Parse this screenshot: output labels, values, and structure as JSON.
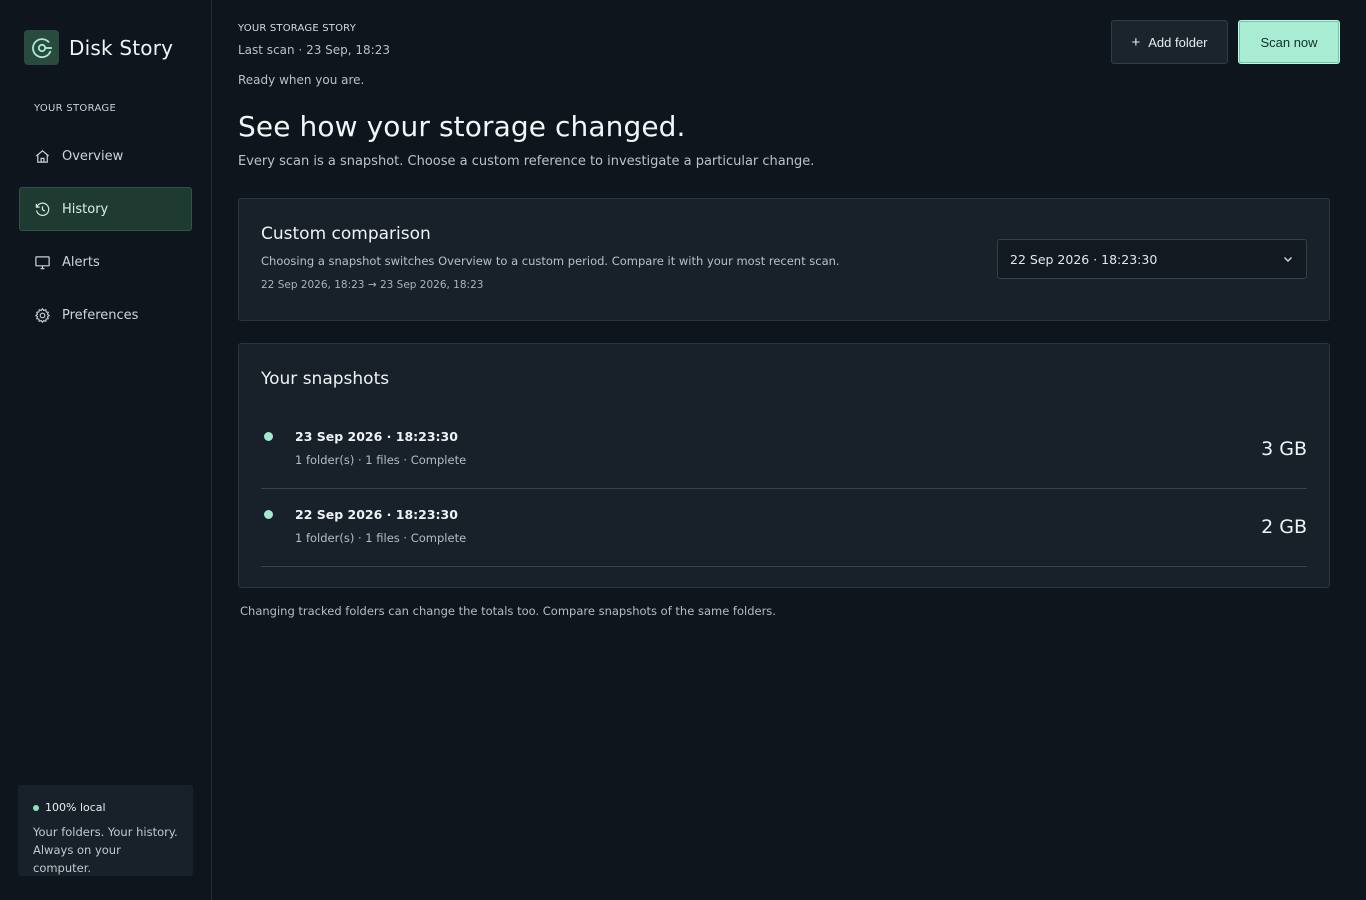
{
  "app": {
    "name": "Disk Story"
  },
  "sidebar": {
    "section_label": "YOUR STORAGE",
    "items": [
      {
        "label": "Overview",
        "icon": "home-icon",
        "active": false
      },
      {
        "label": "History",
        "icon": "history-icon",
        "active": true
      },
      {
        "label": "Alerts",
        "icon": "monitor-icon",
        "active": false
      },
      {
        "label": "Preferences",
        "icon": "gear-icon",
        "active": false
      }
    ],
    "local_card": {
      "title": "100% local",
      "line1": "Your folders. Your history.",
      "line2": "Always on your computer."
    }
  },
  "header": {
    "eyebrow": "YOUR STORAGE STORY",
    "last_scan": "Last scan · 23 Sep, 18:23",
    "status": "Ready when you are.",
    "add_folder_label": "Add folder",
    "add_folder_icon": "plus-icon",
    "scan_now_label": "Scan now"
  },
  "main": {
    "headline": "See how your storage changed.",
    "subhead": "Every scan is a snapshot. Choose a custom reference to investigate a particular change.",
    "comparison": {
      "title": "Custom comparison",
      "description": "Choosing a snapshot switches Overview to a custom period. Compare it with your most recent scan.",
      "range": "22 Sep 2026, 18:23 → 23 Sep 2026, 18:23",
      "selected_snapshot": "22 Sep 2026 · 18:23:30"
    },
    "snapshots": {
      "title": "Your snapshots",
      "items": [
        {
          "date": "23 Sep 2026 · 18:23:30",
          "meta": "1 folder(s) · 1 files · Complete",
          "size": "3 GB"
        },
        {
          "date": "22 Sep 2026 · 18:23:30",
          "meta": "1 folder(s) · 1 files · Complete",
          "size": "2 GB"
        }
      ]
    },
    "footnote": "Changing tracked folders can change the totals too. Compare snapshots of the same folders."
  },
  "colors": {
    "accent": "#a8ecd4",
    "active_nav_bg": "#1f3a30",
    "background": "#0f151c",
    "card": "#18202a"
  }
}
